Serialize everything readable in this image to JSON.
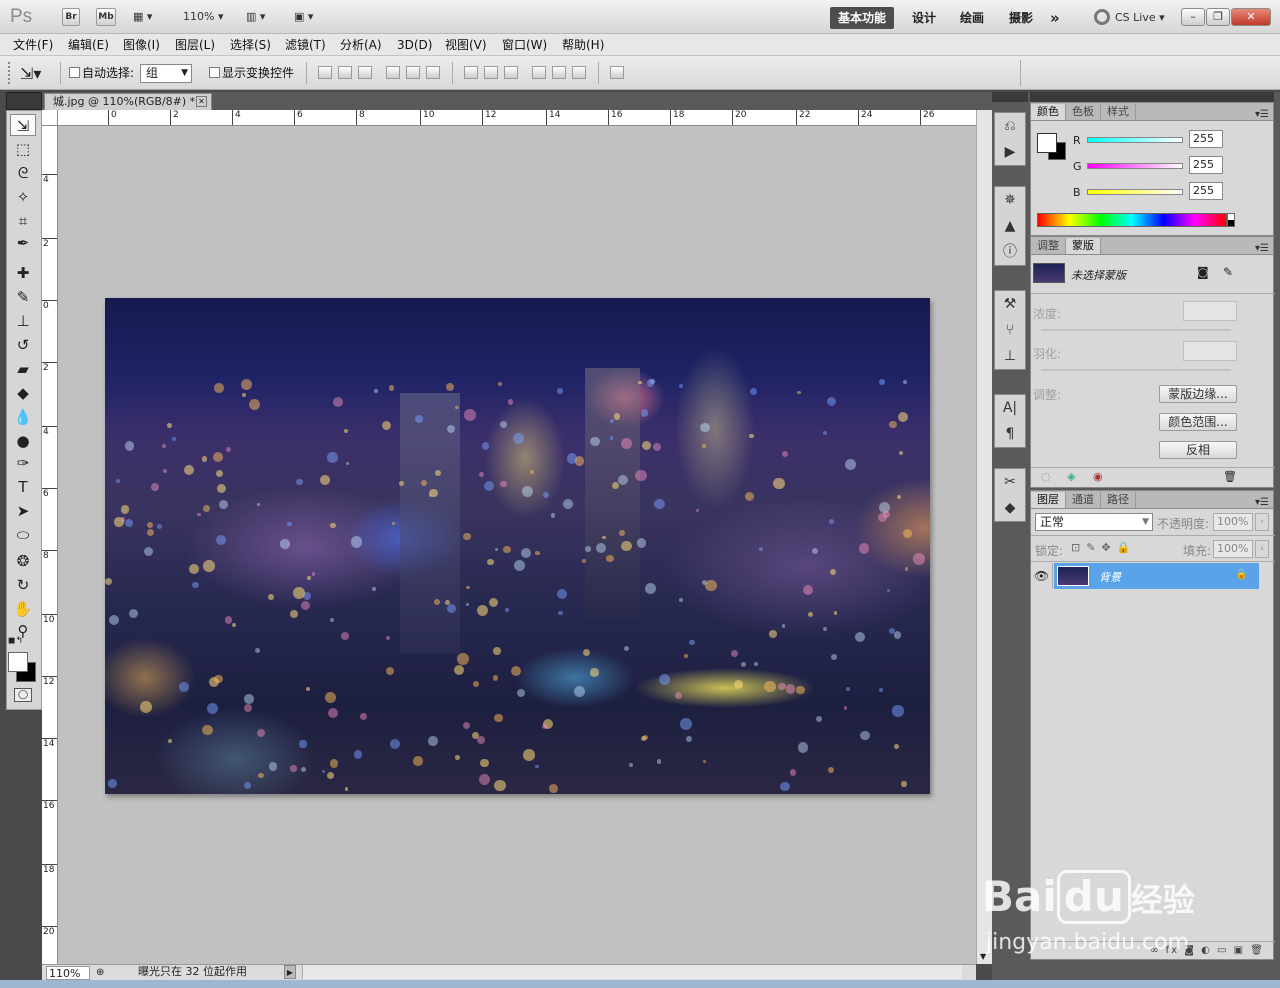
{
  "titlebar": {
    "logo": "Ps",
    "bridge": "Br",
    "minibridge": "Mb",
    "zoom": "110%",
    "workspaces": [
      "基本功能",
      "设计",
      "绘画",
      "摄影"
    ],
    "more": "»",
    "cslive": "CS Live",
    "win_min": "–",
    "win_max": "❐",
    "win_close": "✕"
  },
  "menu": [
    "文件(F)",
    "编辑(E)",
    "图像(I)",
    "图层(L)",
    "选择(S)",
    "滤镜(T)",
    "分析(A)",
    "3D(D)",
    "视图(V)",
    "窗口(W)",
    "帮助(H)"
  ],
  "options": {
    "auto_select_label": "自动选择:",
    "auto_select_value": "组",
    "show_transform_label": "显示变换控件"
  },
  "document": {
    "tab_title": "城.jpg @ 110%(RGB/8#) *",
    "tab_close": "✕",
    "zoom": "110%",
    "status": "曝光只在 32 位起作用"
  },
  "ruler": {
    "top": [
      "0",
      "2",
      "4",
      "6",
      "8",
      "10",
      "12",
      "14",
      "16",
      "18",
      "20",
      "22",
      "24",
      "26"
    ],
    "left": [
      "4",
      "2",
      "0",
      "2",
      "4",
      "6",
      "8",
      "10",
      "12",
      "14",
      "16",
      "18",
      "20"
    ]
  },
  "tools": [
    {
      "name": "move-tool",
      "glyph": "⇲"
    },
    {
      "name": "marquee-tool",
      "glyph": "⬚"
    },
    {
      "name": "lasso-tool",
      "glyph": "ᘓ"
    },
    {
      "name": "quick-select-tool",
      "glyph": "✧"
    },
    {
      "name": "crop-tool",
      "glyph": "⌗"
    },
    {
      "name": "eyedropper-tool",
      "glyph": "✒"
    },
    {
      "name": "healing-tool",
      "glyph": "✚"
    },
    {
      "name": "brush-tool",
      "glyph": "✎"
    },
    {
      "name": "stamp-tool",
      "glyph": "⊥"
    },
    {
      "name": "history-brush-tool",
      "glyph": "↺"
    },
    {
      "name": "eraser-tool",
      "glyph": "▰"
    },
    {
      "name": "bucket-tool",
      "glyph": "◆"
    },
    {
      "name": "blur-tool",
      "glyph": "💧"
    },
    {
      "name": "dodge-tool",
      "glyph": "●"
    },
    {
      "name": "pen-tool",
      "glyph": "✑"
    },
    {
      "name": "type-tool",
      "glyph": "T"
    },
    {
      "name": "path-select-tool",
      "glyph": "➤"
    },
    {
      "name": "shape-tool",
      "glyph": "⬭"
    },
    {
      "name": "3d-rotate-tool",
      "glyph": "❂"
    },
    {
      "name": "3d-orbit-tool",
      "glyph": "↻"
    },
    {
      "name": "hand-tool",
      "glyph": "✋"
    },
    {
      "name": "zoom-tool",
      "glyph": "⚲"
    }
  ],
  "color_panel": {
    "tabs": [
      "颜色",
      "色板",
      "样式"
    ],
    "r_label": "R",
    "g_label": "G",
    "b_label": "B",
    "r": "255",
    "g": "255",
    "b": "255"
  },
  "masks_panel": {
    "tabs": [
      "调整",
      "蒙版"
    ],
    "no_mask": "未选择蒙版",
    "density": "浓度:",
    "feather": "羽化:",
    "refine": "调整:",
    "btn_edge": "蒙版边缘...",
    "btn_range": "颜色范围...",
    "btn_invert": "反相"
  },
  "layers_panel": {
    "tabs": [
      "图层",
      "通道",
      "路径"
    ],
    "blend_mode": "正常",
    "opacity_label": "不透明度:",
    "opacity": "100%",
    "lock_label": "锁定:",
    "fill_label": "填充:",
    "fill": "100%",
    "layer_name": "背景",
    "footer": "∞  fx  ◙  ◐  ▭  ▣  🗑"
  },
  "watermark": {
    "brand": "Bai",
    "brand2": "du",
    "brand3": "经验",
    "url": "jingyan.baidu.com"
  },
  "colors": {
    "accent": "#5ba3e8",
    "layer_selected": "#5ba3e8"
  }
}
